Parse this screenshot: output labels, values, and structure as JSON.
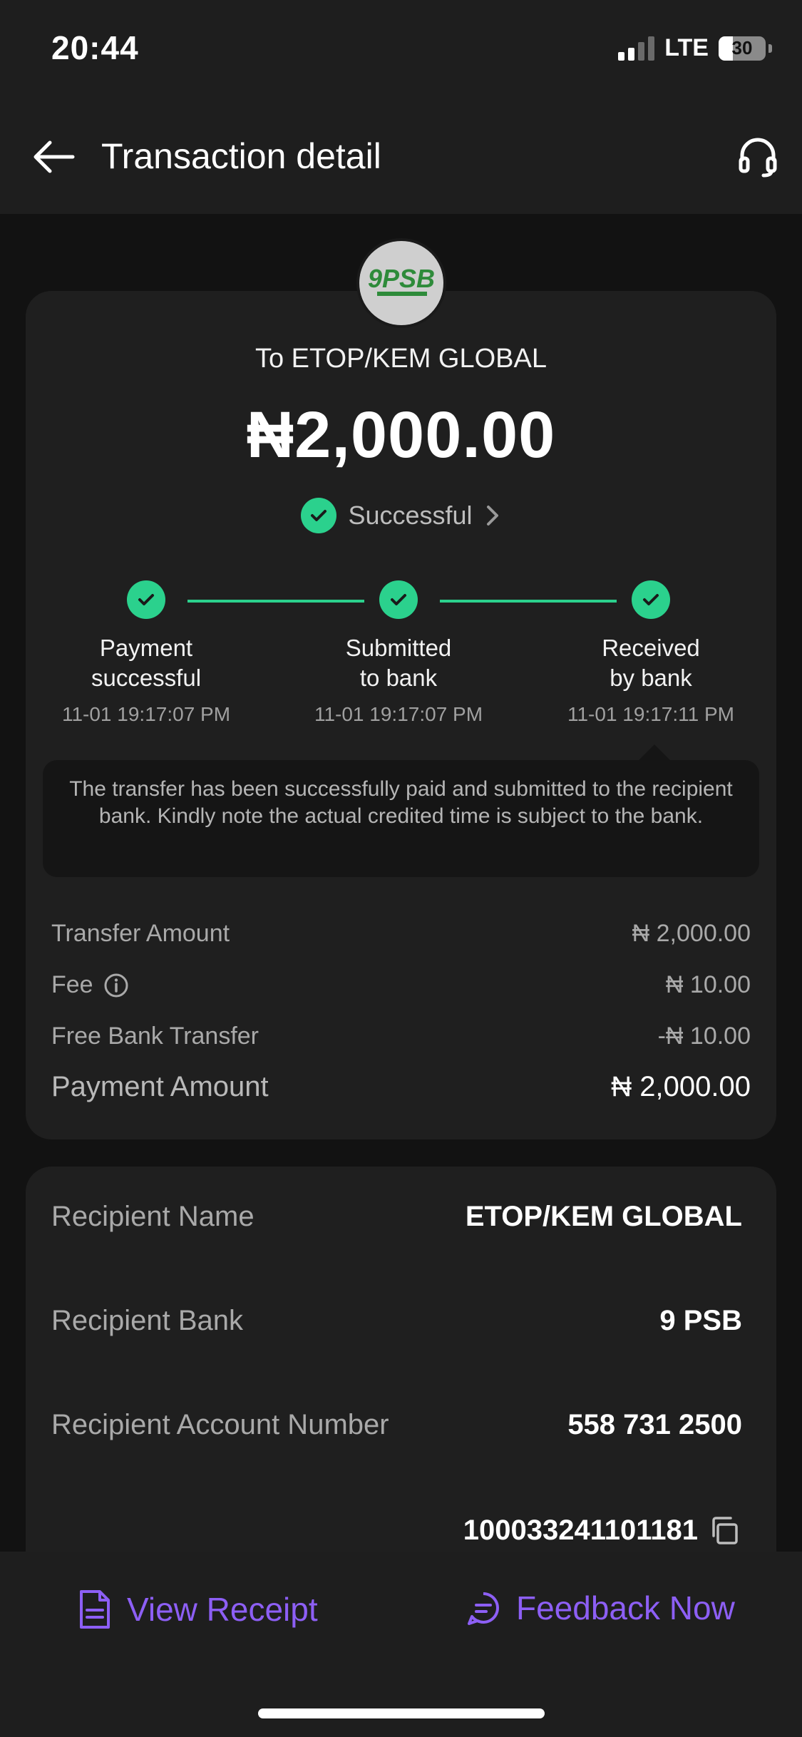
{
  "status_bar": {
    "time": "20:44",
    "network": "LTE",
    "battery": "30"
  },
  "header": {
    "title": "Transaction detail"
  },
  "transaction": {
    "to": "To ETOP/KEM GLOBAL",
    "amount": "₦2,000.00",
    "status": "Successful"
  },
  "timeline": [
    {
      "label": "Payment\nsuccessful",
      "time": "11-01 19:17:07 PM"
    },
    {
      "label": "Submitted\nto bank",
      "time": "11-01 19:17:07 PM"
    },
    {
      "label": "Received\nby bank",
      "time": "11-01 19:17:11 PM"
    }
  ],
  "note": "The transfer has been successfully paid and submitted to the recipient bank. Kindly note the actual credited time is subject to the bank.",
  "fees": {
    "transfer_amount_label": "Transfer Amount",
    "transfer_amount_value": "₦ 2,000.00",
    "fee_label": "Fee",
    "fee_value": "₦ 10.00",
    "free_transfer_label": "Free Bank Transfer",
    "free_transfer_value": "-₦ 10.00",
    "payment_amount_label": "Payment Amount",
    "payment_amount_value": "₦ 2,000.00"
  },
  "recipient": {
    "name_label": "Recipient Name",
    "name_value": "ETOP/KEM GLOBAL",
    "bank_label": "Recipient Bank",
    "bank_value": "9 PSB",
    "account_label": "Recipient Account Number",
    "account_value": "558 731 2500",
    "transaction_no": "100033241101181"
  },
  "bank_logo": {
    "text": "9PSB"
  },
  "bottom": {
    "view_receipt": "View Receipt",
    "feedback": "Feedback Now"
  },
  "colors": {
    "accent_green": "#2bd18d",
    "accent_purple": "#8d5ff5",
    "card_bg": "#1f1f1f"
  }
}
